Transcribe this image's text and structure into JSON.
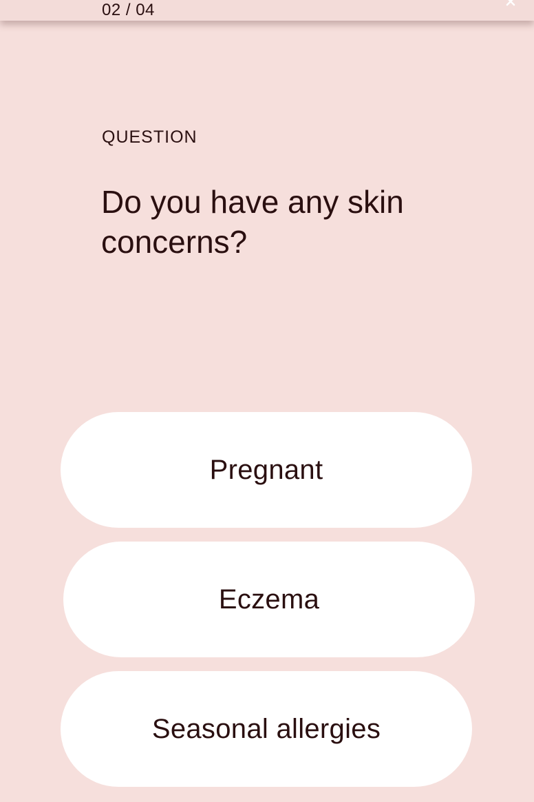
{
  "header": {
    "step_counter": "02 / 04",
    "close_icon": "close-icon"
  },
  "question": {
    "label": "QUESTION",
    "text": "Do you have any skin concerns?"
  },
  "options": [
    {
      "label": "Pregnant"
    },
    {
      "label": "Eczema"
    },
    {
      "label": "Seasonal allergies"
    }
  ],
  "colors": {
    "background": "#f6dfdc",
    "option_background": "#ffffff",
    "text": "#2a0f10"
  }
}
